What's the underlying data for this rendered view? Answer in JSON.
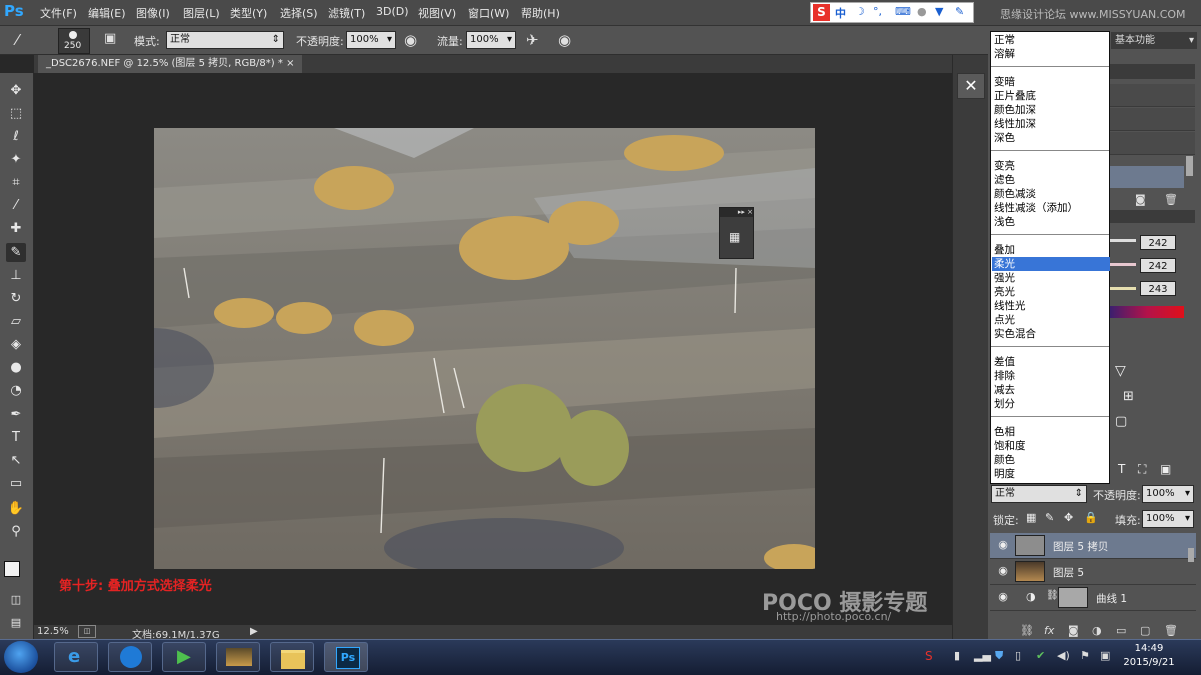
{
  "app": {
    "logo": "Ps"
  },
  "menu": [
    "文件(F)",
    "编辑(E)",
    "图像(I)",
    "图层(L)",
    "类型(Y)",
    "选择(S)",
    "滤镜(T)",
    "3D(D)",
    "视图(V)",
    "窗口(W)",
    "帮助(H)"
  ],
  "ime": {
    "logo": "S",
    "mode": "中",
    "items": [
      "moon-icon",
      "punctuation-icon",
      "keyboard-icon",
      "user-icon",
      "skin-icon",
      "wrench-icon"
    ]
  },
  "top_watermark": "思缘设计论坛 www.MISSYUAN.COM",
  "options": {
    "brush_size": "250",
    "mode_label": "模式:",
    "mode_value": "正常",
    "opacity_label": "不透明度:",
    "opacity_value": "100%",
    "flow_label": "流量:",
    "flow_value": "100%"
  },
  "document_tab": "_DSC2676.NEF @ 12.5% (图层 5 拷贝, RGB/8*) *",
  "canvas": {
    "step_text": "第十步: 叠加方式选择柔光",
    "poco_logo": "POCO 摄影专题",
    "poco_url": "http://photo.poco.cn/"
  },
  "status": {
    "zoom": "12.5%",
    "doc": "文档:69.1M/1.37G"
  },
  "workspace": "基本功能",
  "blend_modes": {
    "groups": [
      [
        "正常",
        "溶解"
      ],
      [
        "变暗",
        "正片叠底",
        "颜色加深",
        "线性加深",
        "深色"
      ],
      [
        "变亮",
        "滤色",
        "颜色减淡",
        "线性减淡（添加）",
        "浅色"
      ],
      [
        "叠加",
        "柔光",
        "强光",
        "亮光",
        "线性光",
        "点光",
        "实色混合"
      ],
      [
        "差值",
        "排除",
        "减去",
        "划分"
      ],
      [
        "色相",
        "饱和度",
        "颜色",
        "明度"
      ]
    ],
    "highlighted": "柔光"
  },
  "color_panel": {
    "r": "242",
    "g": "242",
    "b": "243"
  },
  "layers_panel": {
    "blend_value": "正常",
    "opacity_label": "不透明度:",
    "opacity_value": "100%",
    "lock_label": "锁定:",
    "fill_label": "填充:",
    "fill_value": "100%",
    "layers": [
      {
        "name": "图层 5 拷贝",
        "selected": true
      },
      {
        "name": "图层 5",
        "selected": false
      },
      {
        "name": "曲线 1",
        "selected": false
      }
    ]
  },
  "taskbar": {
    "time": "14:49",
    "date": "2015/9/21"
  },
  "colors": {
    "ps_blue": "#31a8ff",
    "step_red": "#e42323",
    "selection_blue": "#3875d7"
  }
}
